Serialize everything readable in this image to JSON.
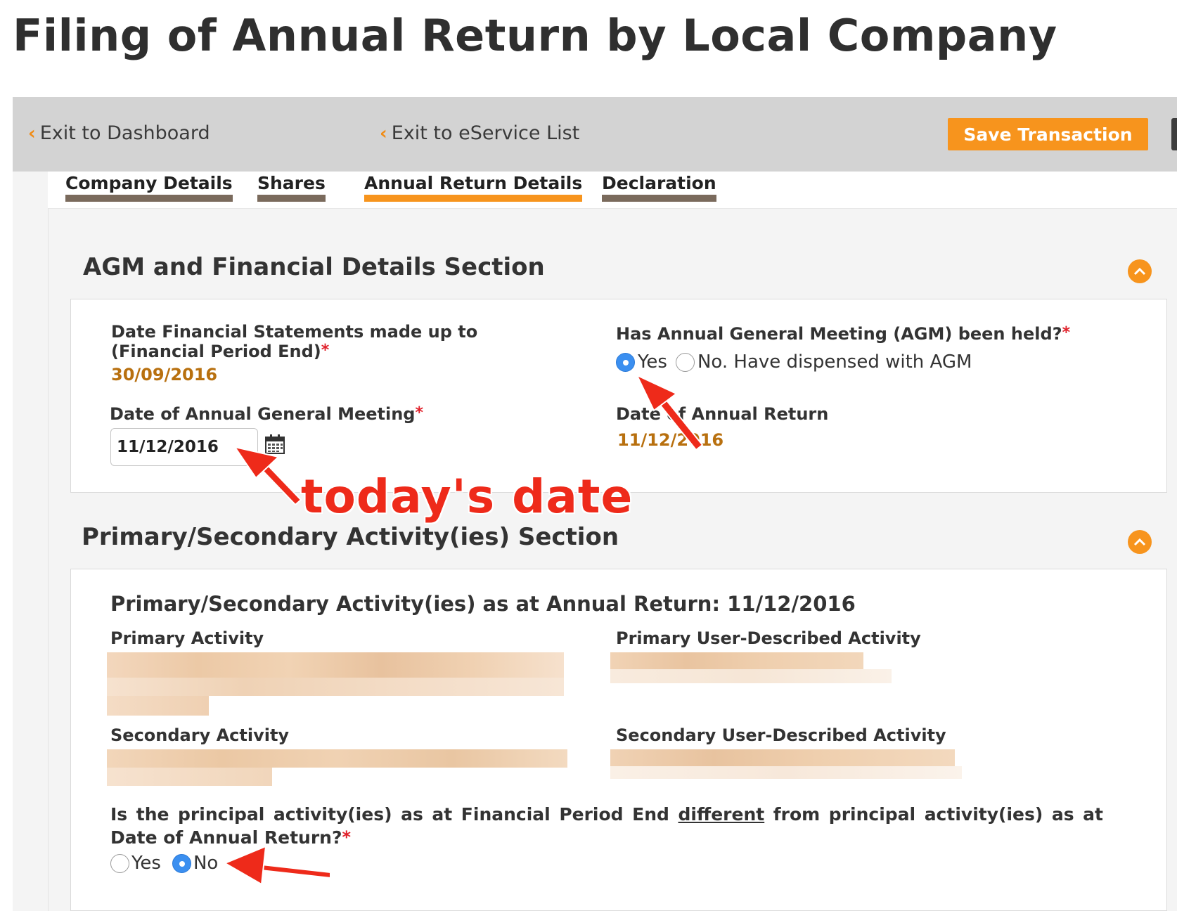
{
  "page_title": "Filing of Annual Return by Local Company",
  "toolbar": {
    "exit_dashboard": "Exit to Dashboard",
    "exit_eservice": "Exit to eService List",
    "save_label": "Save Transaction"
  },
  "tabs": [
    {
      "label": "Company Details",
      "active": false
    },
    {
      "label": "Shares",
      "active": false
    },
    {
      "label": "Annual Return Details",
      "active": true
    },
    {
      "label": "Declaration",
      "active": false
    }
  ],
  "agm_section": {
    "title": "AGM and Financial Details Section",
    "fs_label_line1": "Date Financial Statements made up to",
    "fs_label_line2": "(Financial Period End)",
    "fs_value": "30/09/2016",
    "agm_date_label": "Date of Annual General Meeting",
    "agm_date_value": "11/12/2016",
    "agm_held_label": "Has Annual General Meeting (AGM) been held?",
    "agm_held_options": [
      "Yes",
      "No. Have dispensed with AGM"
    ],
    "agm_held_selected": "Yes",
    "ar_date_label": "Date of Annual Return",
    "ar_date_value": "11/12/2016"
  },
  "activity_section": {
    "title": "Primary/Secondary Activity(ies) Section",
    "subtitle": "Primary/Secondary Activity(ies) as at Annual Return: 11/12/2016",
    "primary_label": "Primary Activity",
    "primary_user_label": "Primary User-Described Activity",
    "secondary_label": "Secondary Activity",
    "secondary_user_label": "Secondary User-Described Activity",
    "question_part1": "Is the principal activity(ies) as at Financial Period End ",
    "question_underlined": "different",
    "question_part2": " from principal activity(ies) as at Date of Annual Return?",
    "answer_options": [
      "Yes",
      "No"
    ],
    "answer_selected": "No"
  },
  "annotations": {
    "callout": "today's date",
    "color": "#ee2a1a"
  },
  "colors": {
    "accent": "#f7941d",
    "tab_bar": "#7a6a5c",
    "value_text": "#b8700f",
    "radio_checked": "#3b8ff0"
  }
}
